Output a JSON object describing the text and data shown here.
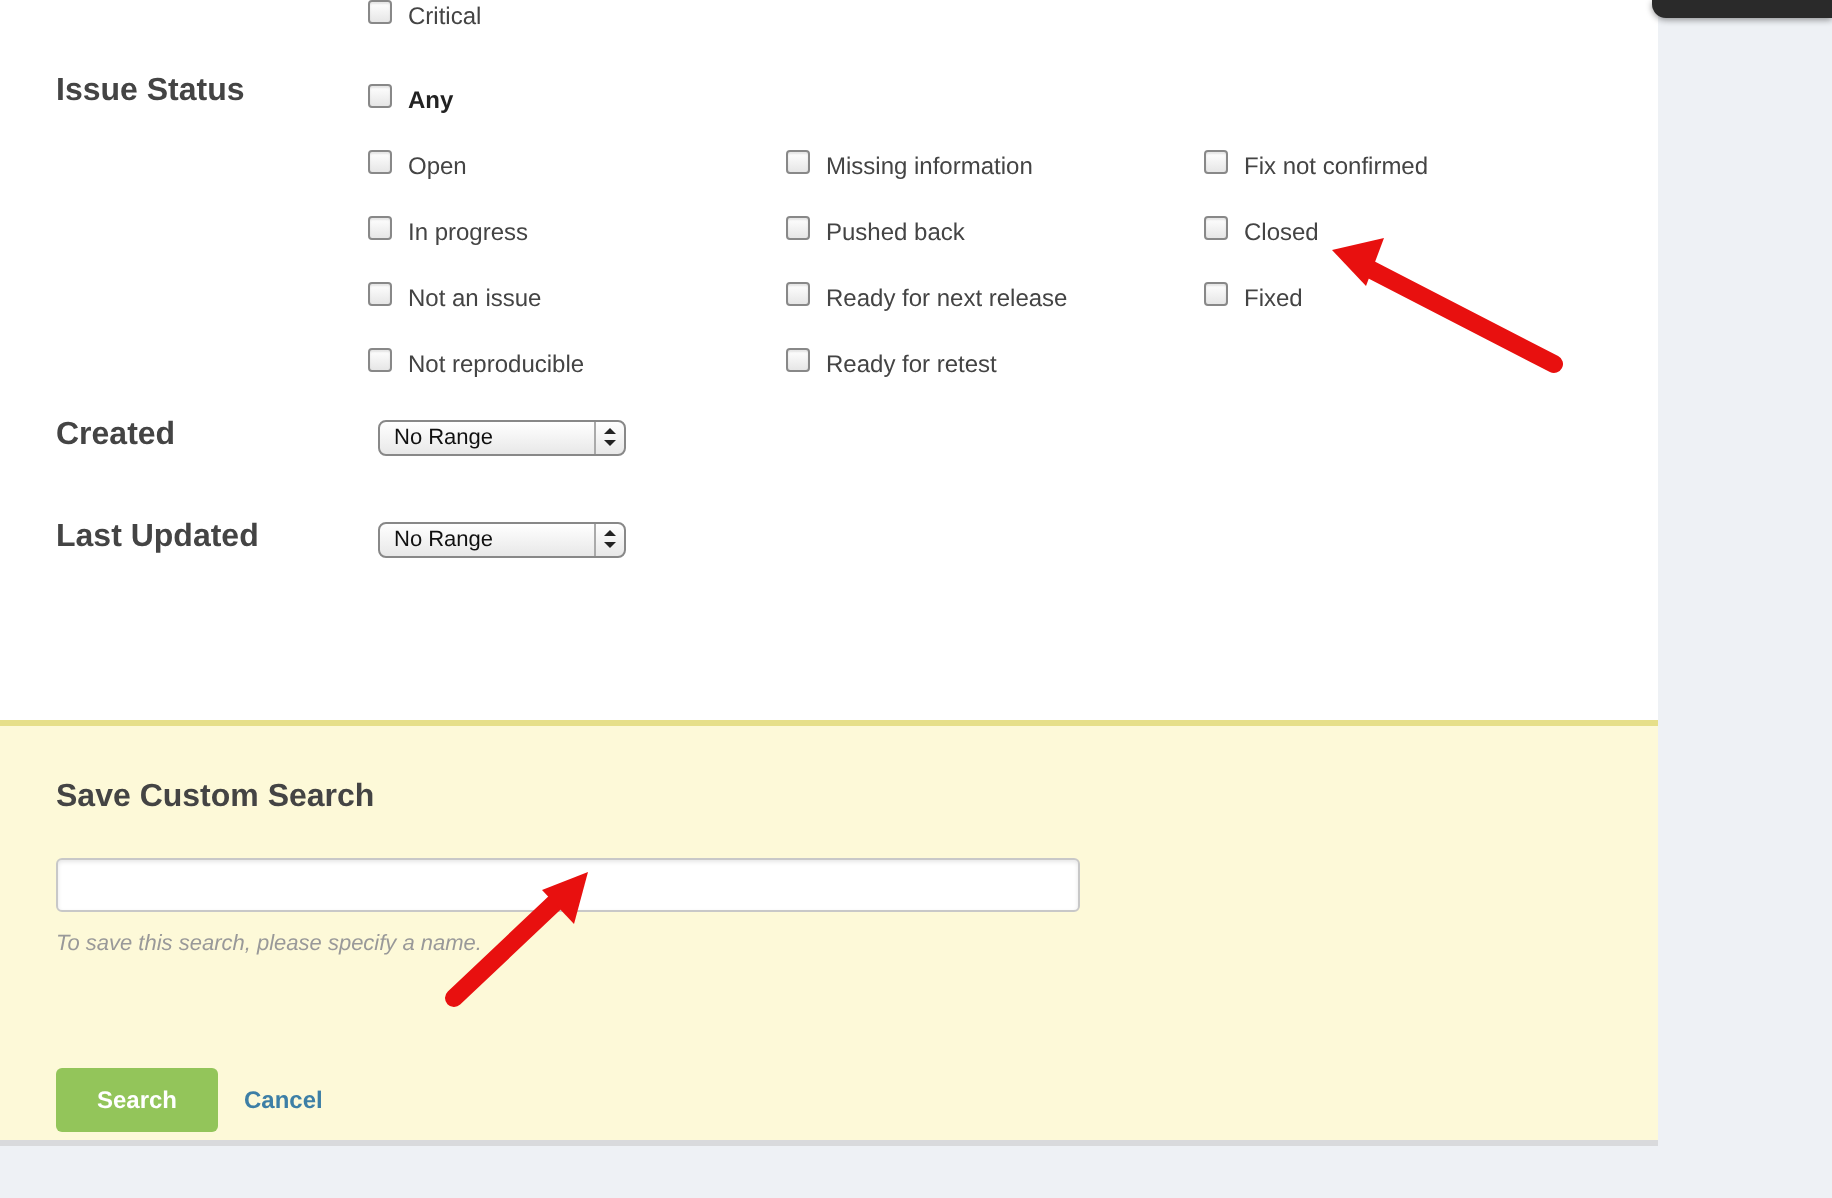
{
  "priority": {
    "options": [
      {
        "label": "Critical",
        "checked": false
      }
    ]
  },
  "issue_status": {
    "label": "Issue Status",
    "any": {
      "label": "Any",
      "checked": false
    },
    "columns": [
      [
        {
          "label": "Open",
          "checked": false
        },
        {
          "label": "In progress",
          "checked": false
        },
        {
          "label": "Not an issue",
          "checked": false
        },
        {
          "label": "Not reproducible",
          "checked": false
        }
      ],
      [
        {
          "label": "Missing information",
          "checked": false
        },
        {
          "label": "Pushed back",
          "checked": false
        },
        {
          "label": "Ready for next release",
          "checked": false
        },
        {
          "label": "Ready for retest",
          "checked": false
        }
      ],
      [
        {
          "label": "Fix not confirmed",
          "checked": false
        },
        {
          "label": "Closed",
          "checked": false
        },
        {
          "label": "Fixed",
          "checked": false
        }
      ]
    ]
  },
  "date_filters": [
    {
      "label": "Created",
      "value": "No Range"
    },
    {
      "label": "Last Updated",
      "value": "No Range"
    }
  ],
  "save_search": {
    "title": "Save Custom Search",
    "hint": "To save this search, please specify a name."
  },
  "actions": [
    {
      "kind": "primary",
      "label": "Search"
    },
    {
      "kind": "link",
      "label": "Cancel"
    }
  ]
}
